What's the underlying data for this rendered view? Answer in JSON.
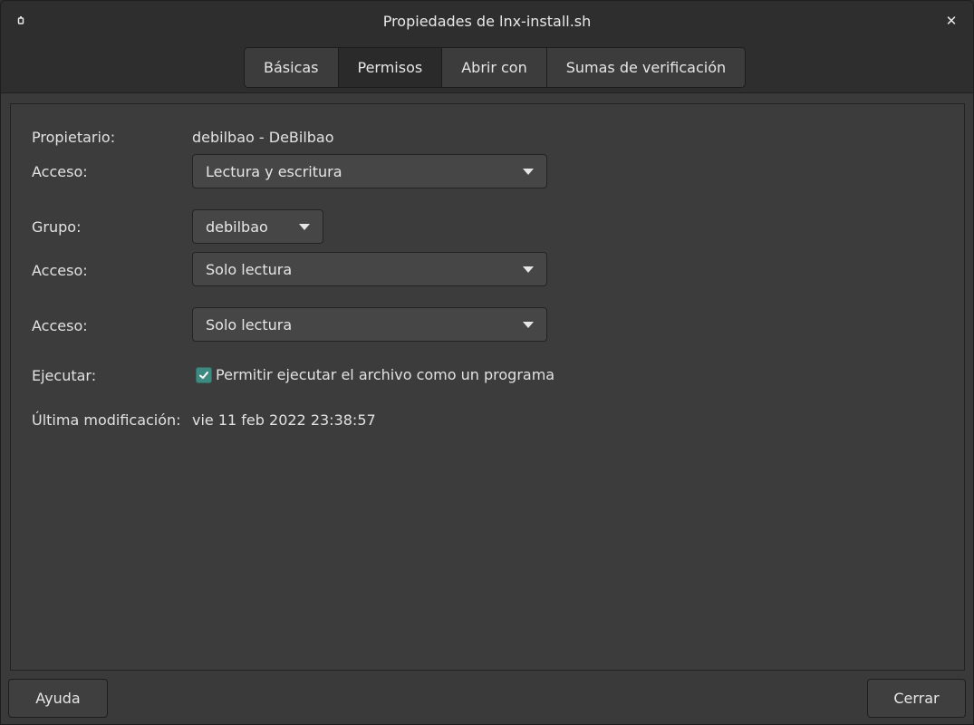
{
  "window": {
    "title": "Propiedades de lnx-install.sh",
    "icon": "pin-icon",
    "close_icon": "close-icon"
  },
  "tabs": [
    {
      "label": "Básicas",
      "active": false
    },
    {
      "label": "Permisos",
      "active": true
    },
    {
      "label": "Abrir con",
      "active": false
    },
    {
      "label": "Sumas de verificación",
      "active": false
    }
  ],
  "permissions": {
    "owner_label": "Propietario:",
    "owner_value": "debilbao - DeBilbao",
    "owner_access_label": "Acceso:",
    "owner_access_value": "Lectura y escritura",
    "group_label": "Grupo:",
    "group_value": "debilbao",
    "group_access_label": "Acceso:",
    "group_access_value": "Solo lectura",
    "others_access_label": "Acceso:",
    "others_access_value": "Solo lectura",
    "execute_label": "Ejecutar:",
    "execute_checkbox_label": "Permitir ejecutar el archivo como un programa",
    "execute_checked": true,
    "modified_label": "Última modificación:",
    "modified_value": "vie 11 feb 2022 23:38:57"
  },
  "buttons": {
    "help": "Ayuda",
    "close": "Cerrar"
  },
  "colors": {
    "accent": "#3e8a80"
  }
}
